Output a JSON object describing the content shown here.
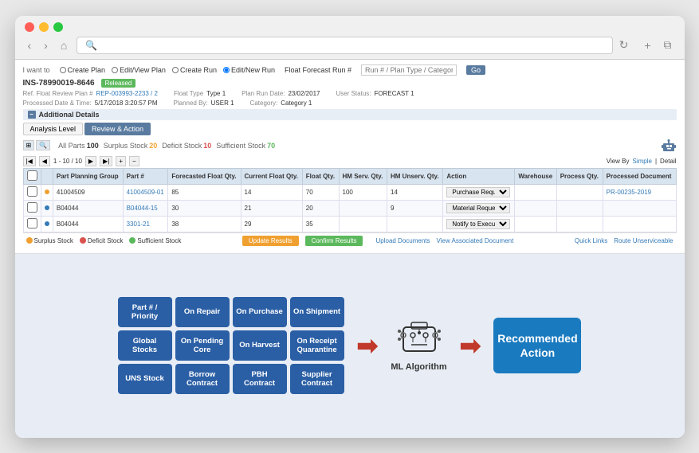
{
  "browser": {
    "address": "search"
  },
  "erp": {
    "toolbar": {
      "label": "I want to",
      "options": [
        "Create Plan",
        "Edit/View Plan",
        "Create Run",
        "Edit/New Run"
      ],
      "selected": "Edit/New Run",
      "float_forecast_label": "Float Forecast Run #",
      "float_input_placeholder": "Run # / Plan Type / Category",
      "go_label": "Go"
    },
    "header": {
      "id": "INS-78990019-8646",
      "status": "Released"
    },
    "fields_row1": {
      "ref_label": "Ref. Float Review Plan #",
      "ref_value": "REP-003993-2233 / 2",
      "float_type_label": "Float Type",
      "float_type_value": "Type 1",
      "plan_run_label": "Plan Run Date:",
      "plan_run_value": "23/02/2017",
      "user_status_label": "User Status:",
      "user_status_value": "FORECAST 1"
    },
    "fields_row2": {
      "processed_label": "Processed Date & Time:",
      "processed_value": "5/17/2018  3:20:57 PM",
      "planned_by_label": "Planned By:",
      "planned_by_value": "USER 1",
      "category_label": "Category:",
      "category_value": "Category 1"
    },
    "section": {
      "title": "Additional Details",
      "tabs": [
        "Analysis Level",
        "Review & Action"
      ]
    },
    "stats": {
      "all_parts_label": "All Parts",
      "all_parts_value": "100",
      "surplus_label": "Surplus Stock",
      "surplus_value": "20",
      "deficit_label": "Deficit Stock",
      "deficit_value": "10",
      "sufficient_label": "Sufficient Stock",
      "sufficient_value": "70"
    },
    "review_section": "Review & Action",
    "pagination": "1 - 10 / 10",
    "view_by_label": "View By",
    "view_options": [
      "Simple",
      "Detail"
    ],
    "table": {
      "headers": [
        "Part Planning Group",
        "Part #",
        "Forecasted Float Qty.",
        "Current Float Qty.",
        "Float Qty.",
        "HM Serv. Qty.",
        "HM Unserv. Qty.",
        "Action",
        "Warehouse",
        "Process Qty.",
        "Processed Document"
      ],
      "rows": [
        {
          "indicator": "orange",
          "part_group": "41004509",
          "part_num": "41004509-01",
          "forecast": "85",
          "current": "14",
          "float": "70",
          "hm_serv": "100",
          "hm_unserv": "14",
          "action": "Purchase Request",
          "warehouse": "",
          "process_qty": "",
          "processed_doc": "PR-00235-2019"
        },
        {
          "indicator": "blue",
          "part_group": "B04044",
          "part_num": "B04044-15",
          "forecast": "30",
          "current": "21",
          "float": "20",
          "hm_serv": "",
          "hm_unserv": "9",
          "action": "Material Request",
          "warehouse": "",
          "process_qty": "",
          "processed_doc": ""
        },
        {
          "indicator": "blue",
          "part_group": "B04044",
          "part_num": "3301-21",
          "forecast": "38",
          "current": "29",
          "float": "35",
          "hm_serv": "",
          "hm_unserv": "",
          "action": "Notify to Execute",
          "warehouse": "",
          "process_qty": "",
          "processed_doc": ""
        }
      ]
    },
    "footer": {
      "legend": [
        {
          "color": "orange",
          "label": "Surplus Stock"
        },
        {
          "color": "red",
          "label": "Deficit Stock"
        },
        {
          "color": "green",
          "label": "Sufficient Stock"
        }
      ],
      "update_btn": "Update Results",
      "confirm_btn": "Confirm Results",
      "upload_label": "Upload Documents",
      "view_doc_label": "View Associated Document",
      "quick_links_label": "Quick Links",
      "route_label": "Route Unserviceable"
    }
  },
  "ml_diagram": {
    "features": [
      {
        "id": "part-priority",
        "label": "Part # /\nPriority"
      },
      {
        "id": "on-repair",
        "label": "On Repair"
      },
      {
        "id": "on-purchase",
        "label": "On Purchase"
      },
      {
        "id": "on-shipment",
        "label": "On Shipment"
      },
      {
        "id": "global-stocks",
        "label": "Global Stocks"
      },
      {
        "id": "on-pending-core",
        "label": "On Pending Core"
      },
      {
        "id": "on-harvest",
        "label": "On Harvest"
      },
      {
        "id": "on-receipt-quarantine",
        "label": "On Receipt Quarantine"
      },
      {
        "id": "uns-stock",
        "label": "UNS Stock"
      },
      {
        "id": "borrow-contract",
        "label": "Borrow Contract"
      },
      {
        "id": "pbh-contract",
        "label": "PBH Contract"
      },
      {
        "id": "supplier-contract",
        "label": "Supplier Contract"
      }
    ],
    "arrow1": "→",
    "arrow2": "→",
    "ml_label": "ML Algorithm",
    "recommended_label": "Recommended Action"
  }
}
